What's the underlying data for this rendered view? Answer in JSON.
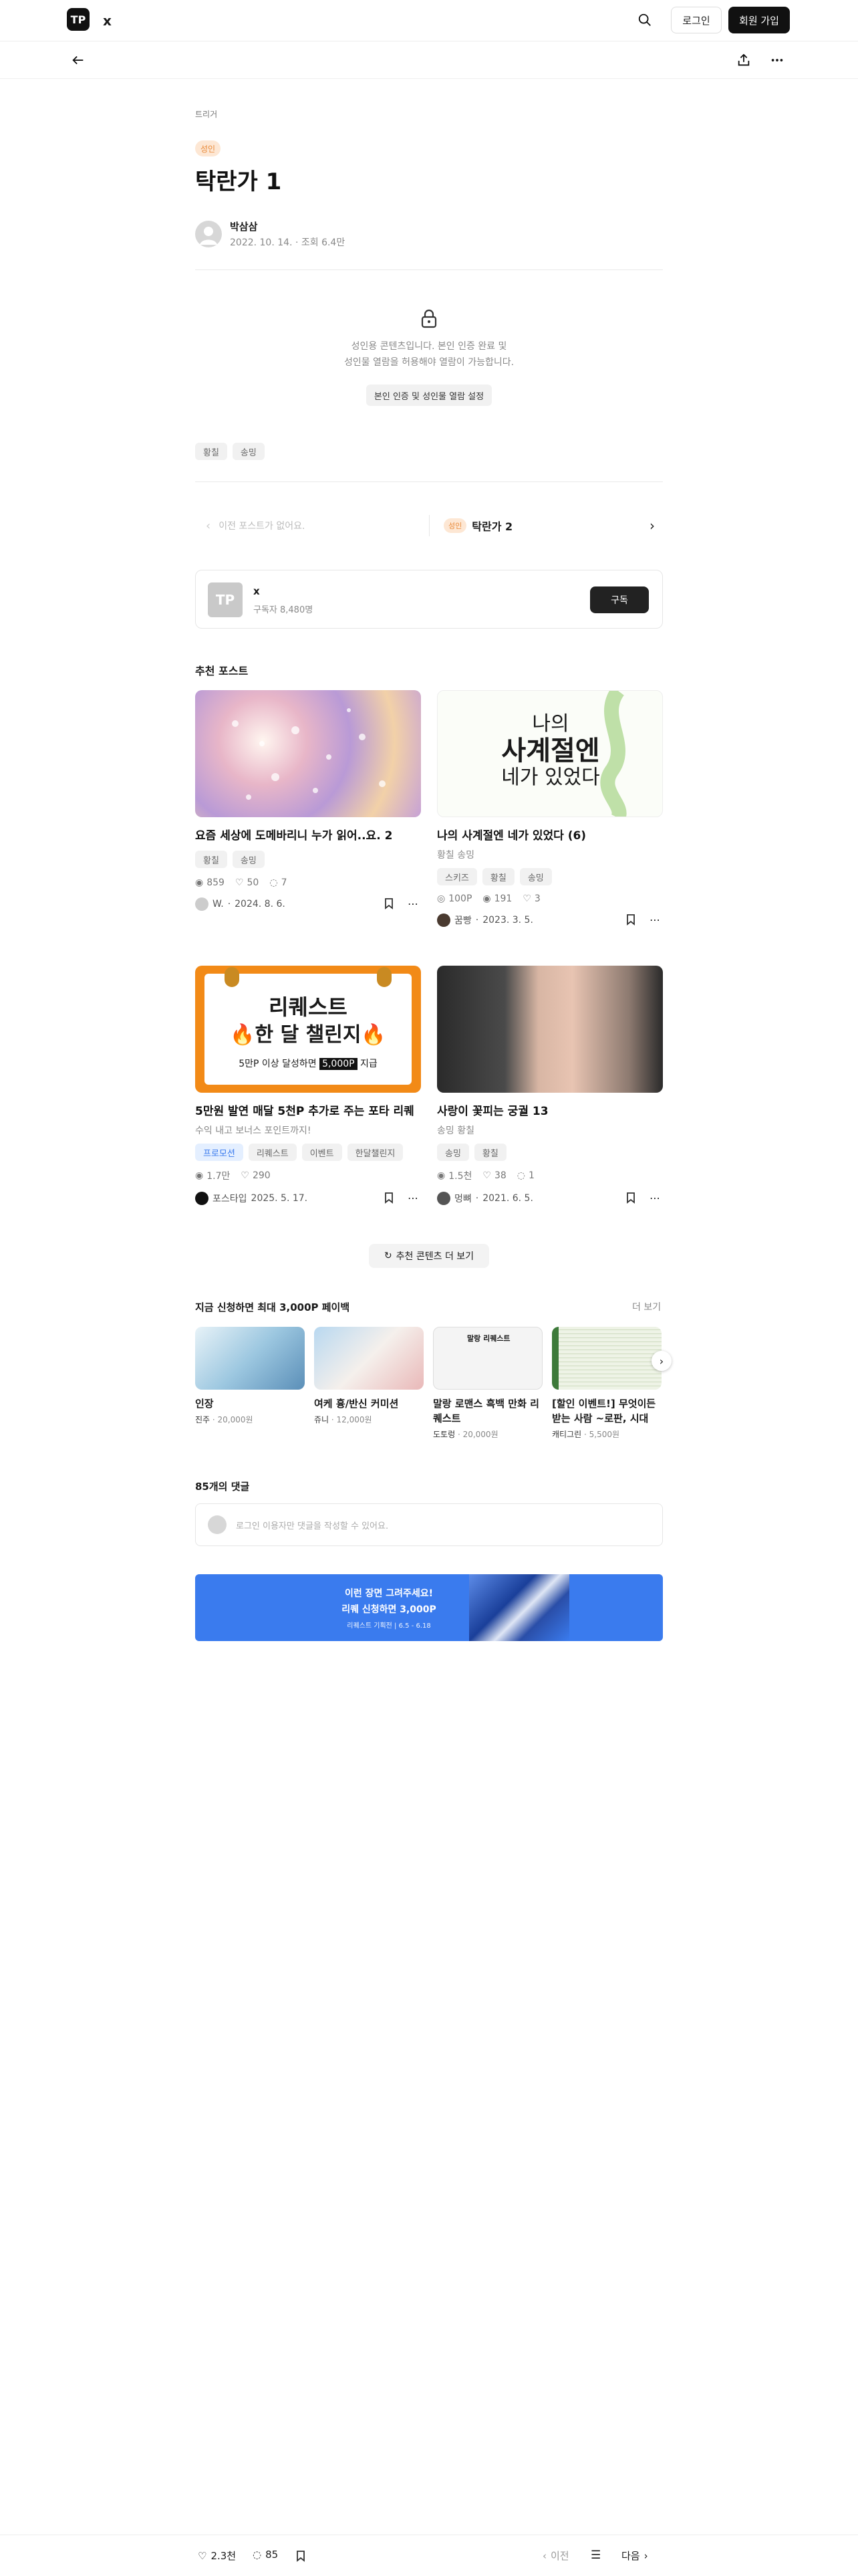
{
  "header": {
    "logo_text": "TP",
    "site_name": "x",
    "login_label": "로그인",
    "join_label": "회원 가입"
  },
  "post": {
    "breadcrumb": "트리거",
    "badge": "성인",
    "title": "탁란가 1",
    "author": "박삼삼",
    "meta": "2022. 10. 14. · 조회 6.4만",
    "lock_text_1": "성인용 콘텐츠입니다. 본인 인증 완료 및",
    "lock_text_2": "성인물 열람을 허용해야 열람이 가능합니다.",
    "lock_button": "본인 인증 및 성인물 열람 설정",
    "tags": [
      "황칠",
      "송밍"
    ]
  },
  "nav": {
    "prev_text": "이전 포스트가 없어요.",
    "next_badge": "성인",
    "next_title": "탁란가 2"
  },
  "channel": {
    "name": "x",
    "subscribers": "구독자 8,480명",
    "subscribe_label": "구독"
  },
  "recommended": {
    "heading": "추천 포스트",
    "more_label": "추천 콘텐츠 더 보기",
    "cards": [
      {
        "title": "요즘 세상에 도메바리니 누가 읽어..요. 2",
        "subtitle": "",
        "tags": [
          "황칠",
          "송밍"
        ],
        "views": "859",
        "likes": "50",
        "comments": "7",
        "author": "W.",
        "date": "2024. 8. 6."
      },
      {
        "title": "나의 사계절엔 네가 있었다 (6)",
        "subtitle": "황칠 송밍",
        "tags": [
          "스키즈",
          "황칠",
          "송밍"
        ],
        "views": "100P",
        "likes": "191",
        "comments": "3",
        "author": "꿈빵",
        "date": "2023. 3. 5."
      },
      {
        "title": "5만원 발연 매달 5천P 추가로 주는 포타 리퀘",
        "subtitle": "수익 내고 보너스 포인트까지!",
        "tags": [
          "프로모션",
          "리퀘스트",
          "이벤트",
          "한달챌린지"
        ],
        "views": "1.7만",
        "likes": "290",
        "comments": "",
        "author": "포스타입",
        "date": "2025. 5. 17."
      },
      {
        "title": "사랑이 꽃피는 궁궐 13",
        "subtitle": "송밍 황칠",
        "tags": [
          "송밍",
          "황칠"
        ],
        "views": "1.5천",
        "likes": "38",
        "comments": "1",
        "author": "멍뼈",
        "date": "2021. 6. 5."
      }
    ],
    "card1_art": {
      "line1": "나의",
      "line2": "사계절엔",
      "line3": "네가 있었다"
    },
    "card3_art": {
      "line1": "리퀘스트",
      "line2": "🔥한 달 챌린지🔥",
      "line3_pre": "5만P 이상 달성하면",
      "line3_highlight": "5,000P",
      "line3_post": "지급"
    }
  },
  "payback": {
    "heading": "지금 신청하면 최대 3,000P 페이백",
    "more_label": "더 보기",
    "items": [
      {
        "title": "인장",
        "seller": "진주",
        "price": "20,000원"
      },
      {
        "title": "여케 흉/반신 커미션",
        "seller": "쥬니",
        "price": "12,000원"
      },
      {
        "title": "말랑 로맨스 흑백 만화 리퀘스트",
        "seller": "도토렁",
        "price": "20,000원"
      },
      {
        "title": "[할인 이벤트!] 무엇이든 받는 사람 ~로판, 시대물…",
        "seller": "캐티그린",
        "price": "5,500원"
      }
    ],
    "item3_art": "말랑 리퀘스트"
  },
  "comments": {
    "heading": "85개의 댓글",
    "placeholder": "로그인 이용자만 댓글을 작성할 수 있어요."
  },
  "banner": {
    "line1": "이런 장면 그려주세요!",
    "line2": "리퀘 신청하면 3,000P",
    "line3": "리퀘스트 기획전 | 6.5 - 6.18"
  },
  "bottom": {
    "likes": "2.3천",
    "comments": "85",
    "prev_label": "이전",
    "next_label": "다음"
  },
  "colors": {
    "accent_badge_bg": "#fde7d4",
    "accent_badge_text": "#e98a3a",
    "banner_bg": "#3a7bee",
    "orange": "#f28a17"
  }
}
